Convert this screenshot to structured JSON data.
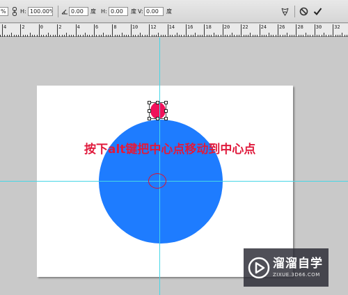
{
  "options_bar": {
    "w_value_suffix": "%",
    "h_label": "H:",
    "h_value": "100.00%",
    "rotate_value": "0.00",
    "rotate_unit": "度",
    "skew_h_label": "H:",
    "skew_h_value": "0.00",
    "skew_h_unit": "度",
    "skew_v_label": "V:",
    "skew_v_value": "0.00",
    "skew_v_unit": "度"
  },
  "ruler": {
    "ticks": [
      "4",
      "2",
      "0",
      "2",
      "4",
      "6",
      "8",
      "10",
      "12",
      "14",
      "16",
      "18",
      "20",
      "22",
      "24",
      "26",
      "28",
      "30",
      "32"
    ]
  },
  "canvas": {
    "annotation": "按下alt键把中心点移动到中心点",
    "colors": {
      "big_circle": "#1e7cff",
      "small_circle": "#f0115a",
      "annotation": "#e01a3c",
      "guide": "#45d6e6"
    }
  },
  "watermark": {
    "title": "溜溜自学",
    "url": "ZIXUE.3D66.COM"
  }
}
